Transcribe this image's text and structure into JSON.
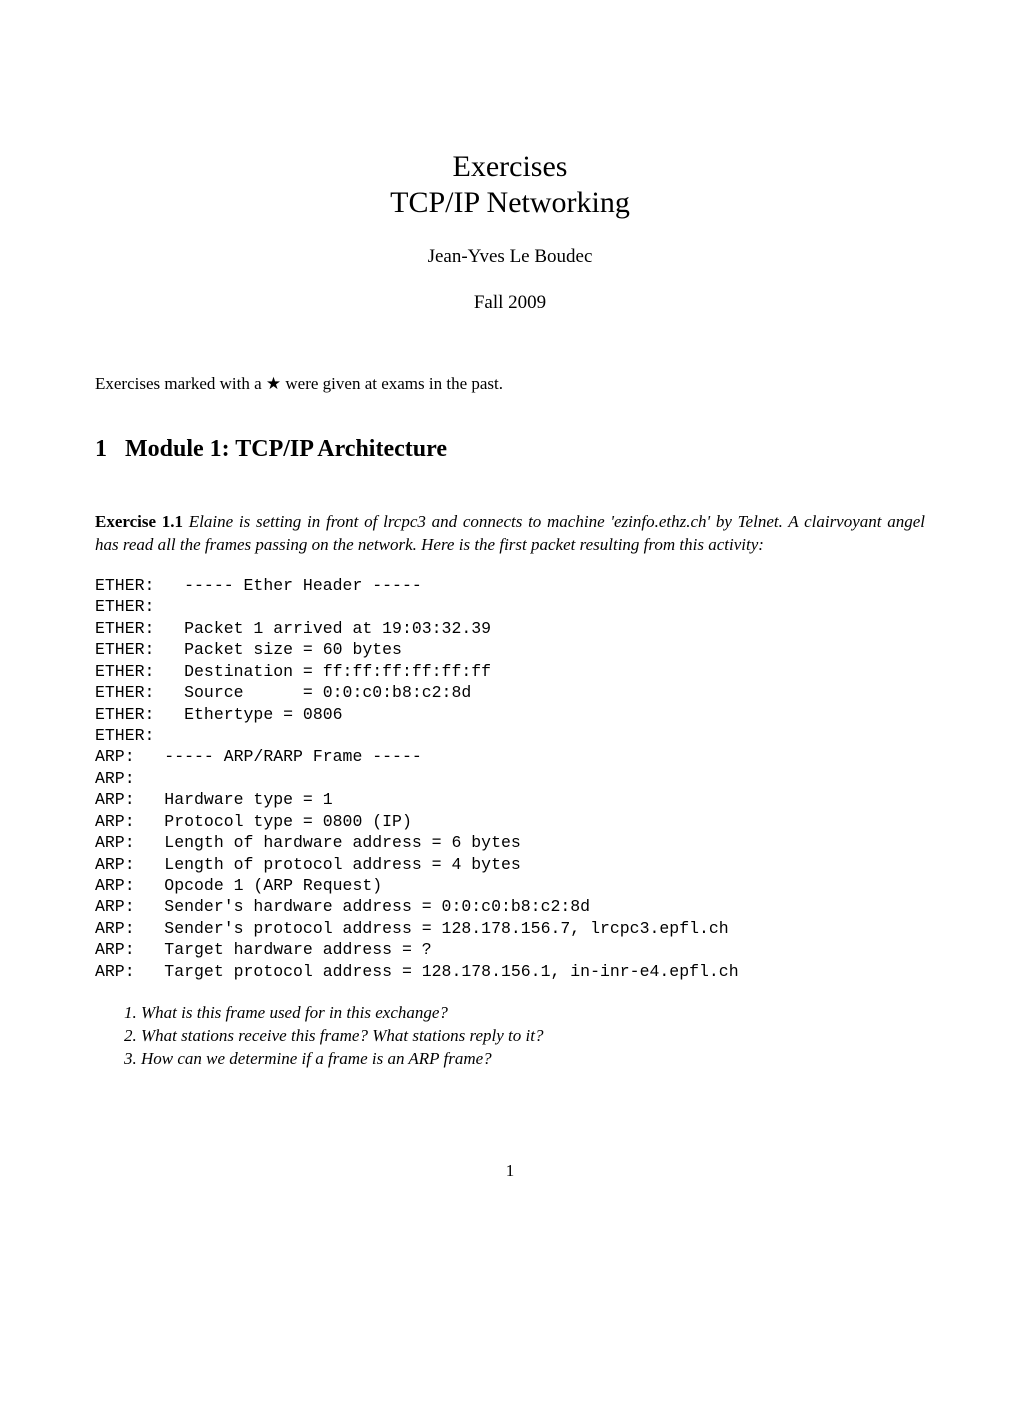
{
  "title_line1": "Exercises",
  "title_line2": "TCP/IP Networking",
  "author": "Jean-Yves Le Boudec",
  "date": "Fall 2009",
  "intro_before_star": "Exercises marked with a ",
  "intro_after_star": " were given at exams in the past.",
  "section_number": "1",
  "section_title": "Module 1: TCP/IP Architecture",
  "exercise_label": "Exercise 1.1",
  "exercise_text": "Elaine is setting in front of lrcpc3 and connects to machine 'ezinfo.ethz.ch' by Telnet. A clairvoyant angel has read all the frames passing on the network. Here is the first packet resulting from this activity:",
  "packet_dump": "ETHER:   ----- Ether Header -----\nETHER:\nETHER:   Packet 1 arrived at 19:03:32.39\nETHER:   Packet size = 60 bytes\nETHER:   Destination = ff:ff:ff:ff:ff:ff\nETHER:   Source      = 0:0:c0:b8:c2:8d\nETHER:   Ethertype = 0806\nETHER:\nARP:   ----- ARP/RARP Frame -----\nARP:\nARP:   Hardware type = 1\nARP:   Protocol type = 0800 (IP)\nARP:   Length of hardware address = 6 bytes\nARP:   Length of protocol address = 4 bytes\nARP:   Opcode 1 (ARP Request)\nARP:   Sender's hardware address = 0:0:c0:b8:c2:8d\nARP:   Sender's protocol address = 128.178.156.7, lrcpc3.epfl.ch\nARP:   Target hardware address = ?\nARP:   Target protocol address = 128.178.156.1, in-inr-e4.epfl.ch",
  "questions": [
    "What is this frame used for in this exchange?",
    "What stations receive this frame? What stations reply to it?",
    "How can we determine if a frame is an ARP frame?"
  ],
  "page_number": "1"
}
